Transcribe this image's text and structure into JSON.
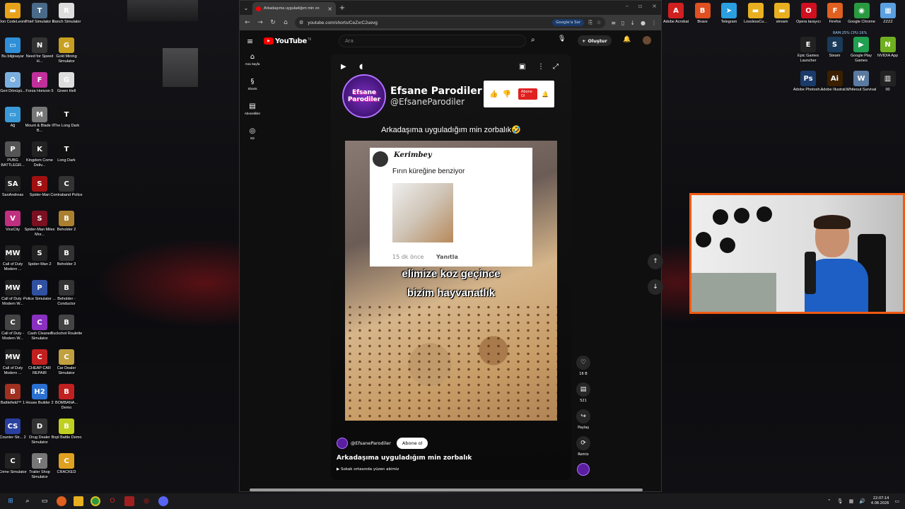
{
  "desktop_left": [
    {
      "label": "Don CodeLeone",
      "color": "#e8a21a",
      "glyph": "▬"
    },
    {
      "label": "Thief Simulator 2",
      "color": "#4a6a8a",
      "glyph": "T"
    },
    {
      "label": "Ranch Simulator",
      "color": "#ddd",
      "glyph": "R"
    },
    {
      "label": "Bu bilgisayar",
      "color": "#2f8fd8",
      "glyph": "▭"
    },
    {
      "label": "Need for Speed H...",
      "color": "#333",
      "glyph": "N"
    },
    {
      "label": "Gold Mining Simulator",
      "color": "#c8a020",
      "glyph": "G"
    },
    {
      "label": "Geri Dönüşü...",
      "color": "#7ab0e0",
      "glyph": "♻"
    },
    {
      "label": "Forza Horizon 5",
      "color": "#c0309a",
      "glyph": "F"
    },
    {
      "label": "Green Hell",
      "color": "#ddd",
      "glyph": "G"
    },
    {
      "label": "Ağ",
      "color": "#3a9ad8",
      "glyph": "▭"
    },
    {
      "label": "Mount & Blade II B...",
      "color": "#777",
      "glyph": "M"
    },
    {
      "label": "The Long Dark",
      "color": "#111",
      "glyph": "T"
    },
    {
      "label": "PUBG BATTLEGR...",
      "color": "#555",
      "glyph": "P"
    },
    {
      "label": "Kingdom Come Deliv...",
      "color": "#222",
      "glyph": "K"
    },
    {
      "label": "Long Dark",
      "color": "#111",
      "glyph": "T"
    },
    {
      "label": "SanAndreas",
      "color": "#222",
      "glyph": "SA"
    },
    {
      "label": "Spider-Man",
      "color": "#a01010",
      "glyph": "S"
    },
    {
      "label": "Contraband Police",
      "color": "#333",
      "glyph": "C"
    },
    {
      "label": "ViceCity",
      "color": "#c03080",
      "glyph": "V"
    },
    {
      "label": "Spider-Man Miles Mor...",
      "color": "#7a1020",
      "glyph": "S"
    },
    {
      "label": "Beholder 2",
      "color": "#aa8030",
      "glyph": "B"
    },
    {
      "label": "Call of Duty Modern ...",
      "color": "#222",
      "glyph": "MW"
    },
    {
      "label": "Spider-Man 2",
      "color": "#222",
      "glyph": "S"
    },
    {
      "label": "Beholder 3",
      "color": "#333",
      "glyph": "B"
    },
    {
      "label": "Call of Duty - Modern W...",
      "color": "#222",
      "glyph": "MW"
    },
    {
      "label": "Police Simulator ...",
      "color": "#3050a0",
      "glyph": "P"
    },
    {
      "label": "Beholder - Conductor",
      "color": "#333",
      "glyph": "B"
    },
    {
      "label": "Call of Duty - Modern W...",
      "color": "#444",
      "glyph": "C"
    },
    {
      "label": "Cash Cleaner Simulator",
      "color": "#8a30c0",
      "glyph": "C"
    },
    {
      "label": "Buckshot Roulette",
      "color": "#444",
      "glyph": "B"
    },
    {
      "label": "Call of Duty Modern ...",
      "color": "#222",
      "glyph": "MW"
    },
    {
      "label": "CHEAP CAR REPAIR",
      "color": "#c02020",
      "glyph": "C"
    },
    {
      "label": "Car Dealer Simulator",
      "color": "#c0a040",
      "glyph": "C"
    },
    {
      "label": "Battlefield™ 1",
      "color": "#a03020",
      "glyph": "B"
    },
    {
      "label": "House Builder 2",
      "color": "#2a70d0",
      "glyph": "H2"
    },
    {
      "label": "BOMBANA... Demo",
      "color": "#c02020",
      "glyph": "B"
    },
    {
      "label": "Counter-Str... 2",
      "color": "#2a40a0",
      "glyph": "CS"
    },
    {
      "label": "Drug Dealer Simulator",
      "color": "#333",
      "glyph": "D"
    },
    {
      "label": "Bopl Battle Demo",
      "color": "#c0d020",
      "glyph": "B"
    },
    {
      "label": "Crime Simulator",
      "color": "#222",
      "glyph": "C"
    },
    {
      "label": "Trailer Shop Simulator",
      "color": "#777",
      "glyph": "T"
    },
    {
      "label": "CRACKED",
      "color": "#e0a020",
      "glyph": "C"
    }
  ],
  "desktop_right": [
    {
      "label": "Adobe Acrobat",
      "color": "#d02020",
      "glyph": "A"
    },
    {
      "label": "Brave",
      "color": "#e05020",
      "glyph": "B"
    },
    {
      "label": "Telegram",
      "color": "#2aa0e0",
      "glyph": "➤"
    },
    {
      "label": "LosslessCu...",
      "color": "#e8b020",
      "glyph": "▬"
    },
    {
      "label": "stream",
      "color": "#e8b020",
      "glyph": "▬"
    },
    {
      "label": "Opera tarayıcı",
      "color": "#d01020",
      "glyph": "O"
    },
    {
      "label": "Firefox",
      "color": "#e06020",
      "glyph": "F"
    },
    {
      "label": "Google Chrome",
      "color": "#2a9a40",
      "glyph": "◉"
    },
    {
      "label": "ZZZZ",
      "color": "#5aa0e0",
      "glyph": "▦"
    },
    {
      "label": "Epic Games Launcher",
      "color": "#222",
      "glyph": "E"
    },
    {
      "label": "Steam",
      "color": "#1a3a5a",
      "glyph": "S"
    },
    {
      "label": "Google Play Games",
      "color": "#20a050",
      "glyph": "▶"
    },
    {
      "label": "NVIDIA App",
      "color": "#70b020",
      "glyph": "N"
    },
    {
      "label": "Adobe Photosh...",
      "color": "#1a3a6a",
      "glyph": "Ps"
    },
    {
      "label": "Adobe Illustrat...",
      "color": "#3a2000",
      "glyph": "Ai"
    },
    {
      "label": "Whiteout Survival",
      "color": "#5a7aa0",
      "glyph": "W"
    },
    {
      "label": "00",
      "color": "#222",
      "glyph": "▥"
    }
  ],
  "perf_overlay": "RAM:25%  CPU:16%",
  "browser": {
    "tab_title": "Arkadaşıma uyguladığım min zo",
    "url": "youtube.com/shorts/CeZxrC2uevg",
    "google_sor": "Google'a Sor"
  },
  "youtube": {
    "logo": "YouTube",
    "logo_sup": "TR",
    "search_placeholder": "Ara",
    "create_label": "Oluştur",
    "nav": [
      {
        "label": "Ana Sayfa",
        "icon": "⌂"
      },
      {
        "label": "Shorts",
        "icon": "§"
      },
      {
        "label": "Abonelikler",
        "icon": "▤"
      },
      {
        "label": "Siz",
        "icon": "◎"
      }
    ]
  },
  "short": {
    "channel_logo_text": "Efsane Parodiler",
    "channel_name": "Efsane Parodiler",
    "channel_handle": "@EfsaneParodiler",
    "subscribe_card": "Abone Ol",
    "caption_top": "Arkadaşıma uyguladığım min zorbalık🤣",
    "comment_user": "Kerimbey",
    "comment_text": "Fırın küreğine benziyor",
    "comment_time": "15 dk önce",
    "comment_reply": "Yanıtla",
    "overlay_line1": "elimize koz geçince",
    "overlay_line2": "bizim hayvanatlık",
    "bottom_handle": "@EfsaneParodiler",
    "bottom_subscribe": "Abone ol",
    "bottom_title": "Arkadaşıma uyguladığım min zorbalık",
    "music": "Sokak ortasında yüzen abimiz"
  },
  "actions": {
    "likes": "16 B",
    "comments": "521",
    "share": "Paylaş",
    "remix": "Remix"
  },
  "taskbar": {
    "time": "22:07:14",
    "date": "4.08.2026"
  }
}
